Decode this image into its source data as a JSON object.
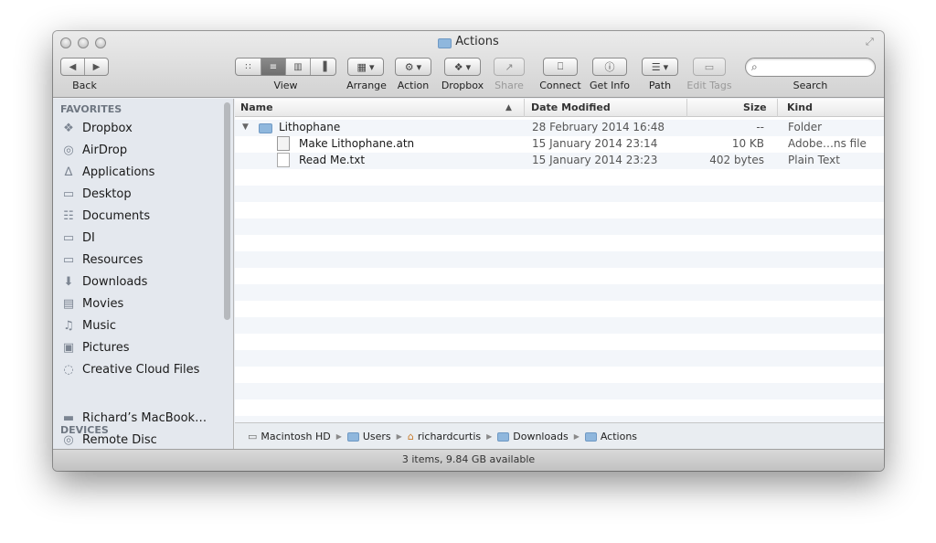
{
  "window": {
    "title": "Actions"
  },
  "toolbar": {
    "back_label": "Back",
    "view_label": "View",
    "arrange_label": "Arrange",
    "action_label": "Action",
    "dropbox_label": "Dropbox",
    "share_label": "Share",
    "connect_label": "Connect",
    "getinfo_label": "Get Info",
    "path_label": "Path",
    "edittags_label": "Edit Tags",
    "search_label": "Search",
    "search_placeholder": ""
  },
  "sidebar": {
    "favorites_header": "FAVORITES",
    "favorites": [
      {
        "label": "Dropbox",
        "icon": "dropbox-icon"
      },
      {
        "label": "AirDrop",
        "icon": "airdrop-icon"
      },
      {
        "label": "Applications",
        "icon": "applications-icon"
      },
      {
        "label": "Desktop",
        "icon": "desktop-icon"
      },
      {
        "label": "Documents",
        "icon": "documents-icon"
      },
      {
        "label": "DI",
        "icon": "folder-icon"
      },
      {
        "label": "Resources",
        "icon": "folder-icon"
      },
      {
        "label": "Downloads",
        "icon": "downloads-icon"
      },
      {
        "label": "Movies",
        "icon": "movies-icon"
      },
      {
        "label": "Music",
        "icon": "music-icon"
      },
      {
        "label": "Pictures",
        "icon": "pictures-icon"
      },
      {
        "label": "Creative Cloud Files",
        "icon": "creative-cloud-icon"
      }
    ],
    "devices_header": "DEVICES",
    "devices": [
      {
        "label": "Richard’s MacBook…",
        "icon": "laptop-icon"
      },
      {
        "label": "Remote Disc",
        "icon": "disc-icon"
      }
    ]
  },
  "list": {
    "columns": {
      "name": "Name",
      "date": "Date Modified",
      "size": "Size",
      "kind": "Kind"
    },
    "rows": [
      {
        "name": "Lithophane",
        "date": "28 February 2014 16:48",
        "size": "--",
        "kind": "Folder",
        "icon": "folder-icon",
        "expanded": true,
        "indent": 0
      },
      {
        "name": "Make Lithophane.atn",
        "date": "15 January 2014 23:14",
        "size": "10 KB",
        "kind": "Adobe…ns file",
        "icon": "atn-file-icon",
        "indent": 1
      },
      {
        "name": "Read Me.txt",
        "date": "15 January 2014 23:23",
        "size": "402 bytes",
        "kind": "Plain Text",
        "icon": "text-file-icon",
        "indent": 1
      }
    ]
  },
  "pathbar": {
    "items": [
      {
        "label": "Macintosh HD",
        "icon": "hard-drive-icon"
      },
      {
        "label": "Users",
        "icon": "folder-icon"
      },
      {
        "label": "richardcurtis",
        "icon": "home-icon"
      },
      {
        "label": "Downloads",
        "icon": "folder-icon"
      },
      {
        "label": "Actions",
        "icon": "folder-icon"
      }
    ]
  },
  "status": {
    "text": "3 items, 9.84 GB available"
  },
  "colors": {
    "folder": "#8fb7dd",
    "sidebar_bg": "#e4e8ee",
    "row_stripe": "#f3f6fa"
  }
}
